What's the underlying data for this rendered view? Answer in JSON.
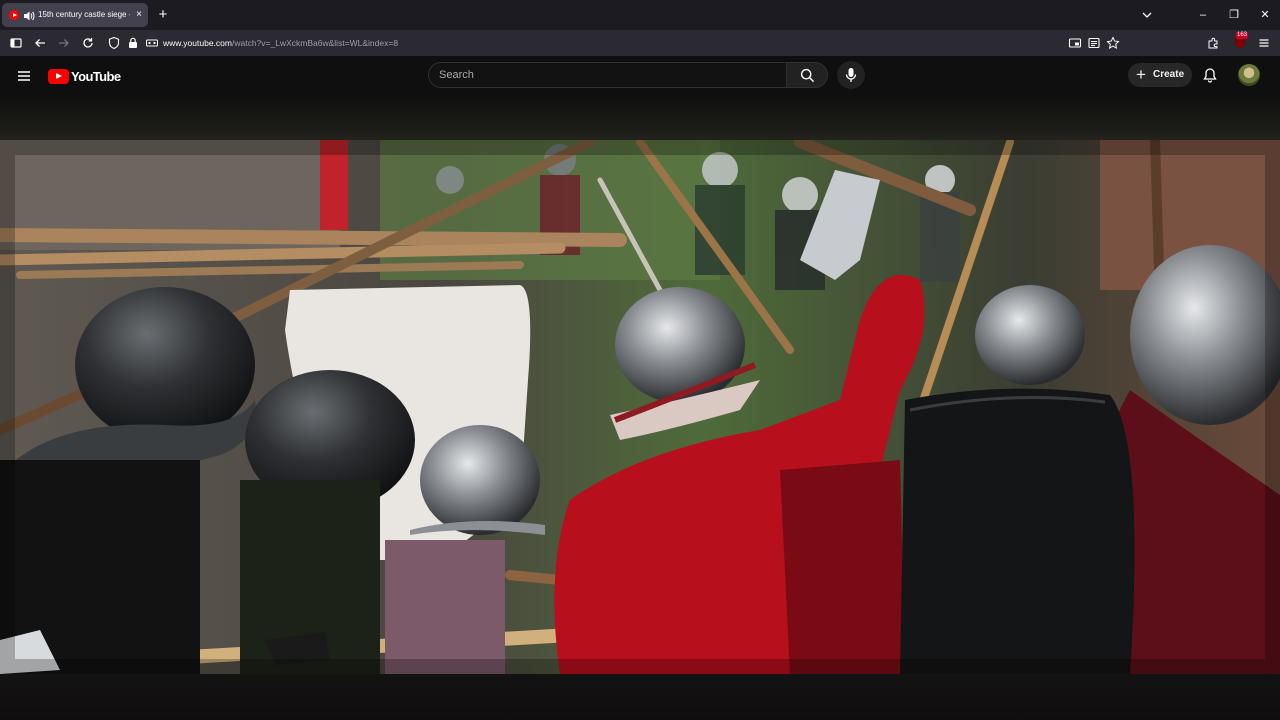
{
  "browser": {
    "tab": {
      "title": "15th century castle siege -",
      "close_glyph": "×"
    },
    "new_tab_glyph": "+",
    "address": {
      "host": "www.youtube.com",
      "path": "/watch?v=_LwXckmBa6w&list=WL&index=8"
    },
    "extension_badge_count": "163",
    "window_controls": {
      "minimize": "–",
      "restore": "❐",
      "close": "✕"
    }
  },
  "youtube": {
    "logo_text": "YouTube",
    "search": {
      "placeholder": "Search",
      "value": ""
    },
    "create_label": "Create",
    "create_glyph": "+"
  },
  "colors": {
    "youtube_red": "#ff0000",
    "page_background": "#0f0f0f",
    "browser_chrome": "#2b2a33",
    "tab_active": "#42414d"
  },
  "icons": {
    "tab": [
      "youtube-favicon",
      "speaker-icon",
      "close-icon"
    ],
    "nav": [
      "sidebar-icon",
      "back-arrow-icon",
      "forward-arrow-icon",
      "reload-icon",
      "shield-icon",
      "lock-icon",
      "permissions-icon"
    ],
    "address_right": [
      "picture-in-picture-icon",
      "reader-view-icon",
      "bookmark-star-icon"
    ],
    "toolbar_right": [
      "extensions-icon",
      "ublock-icon",
      "hamburger-menu-icon"
    ],
    "youtube": [
      "guide-menu-icon",
      "search-icon",
      "microphone-icon",
      "create-plus-icon",
      "notifications-bell-icon",
      "avatar"
    ]
  },
  "video": {
    "scene": "medieval battle reenactment"
  }
}
